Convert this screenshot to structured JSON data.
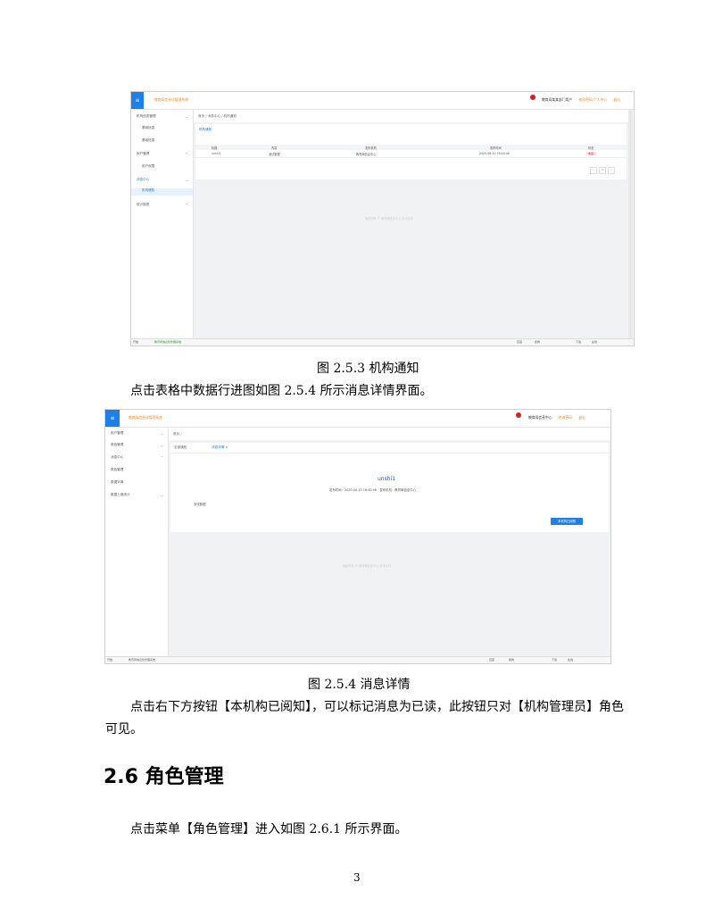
{
  "screenshot1": {
    "app_title": "教育局信息化管理系统",
    "header_right": {
      "user": "教育局某某部门用户",
      "link1": "修改密码/个人中心",
      "link2": "退出"
    },
    "sidebar": [
      {
        "label": "机构信息管理",
        "type": "group"
      },
      {
        "label": "基础信息",
        "type": "sub"
      },
      {
        "label": "基础信息",
        "type": "sub"
      },
      {
        "label": "用户管理",
        "type": "group"
      },
      {
        "label": "用户权限",
        "type": "sub"
      },
      {
        "label": "消息中心",
        "type": "group-active"
      },
      {
        "label": "机构通知",
        "type": "sub-selected"
      },
      {
        "label": "统计报表",
        "type": "group"
      }
    ],
    "breadcrumb": "首页 / 消息中心 / 机构通知",
    "tab": "机构通知",
    "table": {
      "headers": [
        "标题",
        "内容",
        "发布机构",
        "发布时间",
        "状态"
      ],
      "row": [
        "unshi1",
        "测试数据",
        "教育局信息中心",
        "2020-06-10 16:40:46",
        "未读"
      ]
    },
    "pager": [
      "‹",
      "1",
      "›"
    ],
    "faint_text": "版权所有 © 教育局信息中心 技术支持",
    "taskbar": {
      "start": "开始",
      "item": "教育局信息化管理系统",
      "right": [
        "百度",
        "搜狗",
        "下载",
        "在线"
      ]
    }
  },
  "caption1": "图 2.5.3 机构通知",
  "para1": "点击表格中数据行进图如图 2.5.4 所示消息详情界面。",
  "screenshot2": {
    "app_title": "教育局信息化管理系统",
    "header_right": {
      "user": "教育局信息中心",
      "link1": "修改密码",
      "link2": "退出"
    },
    "sidebar": [
      {
        "label": "用户管理",
        "type": "group"
      },
      {
        "label": "角色管理",
        "type": "group"
      },
      {
        "label": "消息中心",
        "type": "group"
      },
      {
        "label": "角色管理",
        "type": "plain"
      },
      {
        "label": "数据字典",
        "type": "plain"
      },
      {
        "label": "数据上报统计",
        "type": "group"
      }
    ],
    "breadcrumb": "首页 /",
    "tabs": [
      "全部通知",
      "消息详情 ×"
    ],
    "message": {
      "title": "unshi1",
      "meta": "发布时间：2020-06-10 16:40:46　发布机构：教育局信息中心",
      "body": "测试数据",
      "ack_button": "本机构已阅知"
    },
    "faint_text": "版权所有 © 教育局信息中心 技术支持",
    "taskbar": {
      "start": "开始",
      "item": "教育局信息化管理系统",
      "right": [
        "百度",
        "搜狗",
        "下载",
        "在线"
      ]
    }
  },
  "caption2": "图 2.5.4 消息详情",
  "para2_line1": "点击右下方按钮【本机构已阅知】，可以标记消息为已读，此按钮只对【机构管理员】角色",
  "para2_line2": "可见。",
  "heading": "2.6 角色管理",
  "para3": "点击菜单【角色管理】进入如图 2.6.1 所示界面。",
  "page_number": "3"
}
